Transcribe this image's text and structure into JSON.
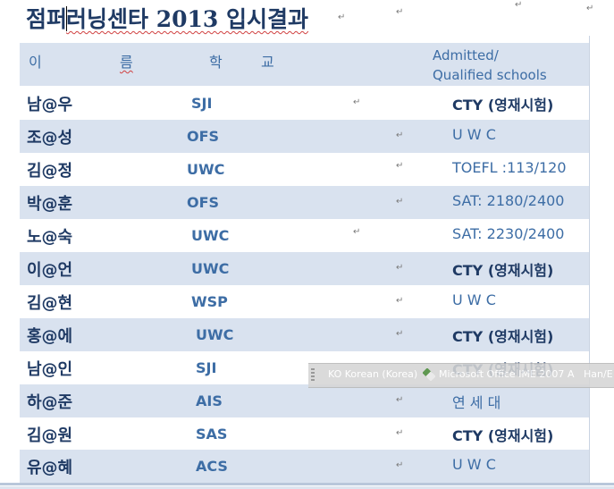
{
  "doc": {
    "title_a": "점퍼",
    "title_b": "러닝센타 2013  입시결과",
    "paragraph_mark": "↵"
  },
  "table": {
    "header": {
      "name_1": "이",
      "name_2": "름",
      "school_1": "학",
      "school_2": "교",
      "admitted_line1": "Admitted/",
      "admitted_line2": "Qualified schools"
    },
    "rows": [
      {
        "name": "남@우",
        "school": "SJI",
        "result": "CTY (영재시험)"
      },
      {
        "name": "조@성",
        "school": "OFS",
        "result": "U        W        C"
      },
      {
        "name": "김@정",
        "school": "UWC",
        "result": "TOEFL :113/120"
      },
      {
        "name": "박@훈",
        "school": "OFS",
        "result": "SAT:  2180/2400"
      },
      {
        "name": "노@숙",
        "school": "UWC",
        "result": "SAT:  2230/2400"
      },
      {
        "name": "이@언",
        "school": "UWC",
        "result": "CTY  (영재시험)"
      },
      {
        "name": "김@현",
        "school": "WSP",
        "result": "U        W        C"
      },
      {
        "name": "홍@에",
        "school": "UWC",
        "result": "CTY  (영재시험)"
      },
      {
        "name": "남@인",
        "school": "SJI",
        "result": "CTY  (영재시험)"
      },
      {
        "name": "하@준",
        "school": "AIS",
        "result": "연        세        대"
      },
      {
        "name": "김@원",
        "school": "SAS",
        "result": "CTY  (영재시험)"
      },
      {
        "name": "유@혜",
        "school": "ACS",
        "result": "U        W        C"
      }
    ]
  },
  "language_bar": {
    "language": "KO Korean (Korea)",
    "ime": "Microsoft Office IME 2007",
    "mode": "Han/E"
  },
  "colors": {
    "row_shade": "#d9e2ef",
    "text_dark": "#1f3a64",
    "text_blue": "#3d6da5"
  }
}
